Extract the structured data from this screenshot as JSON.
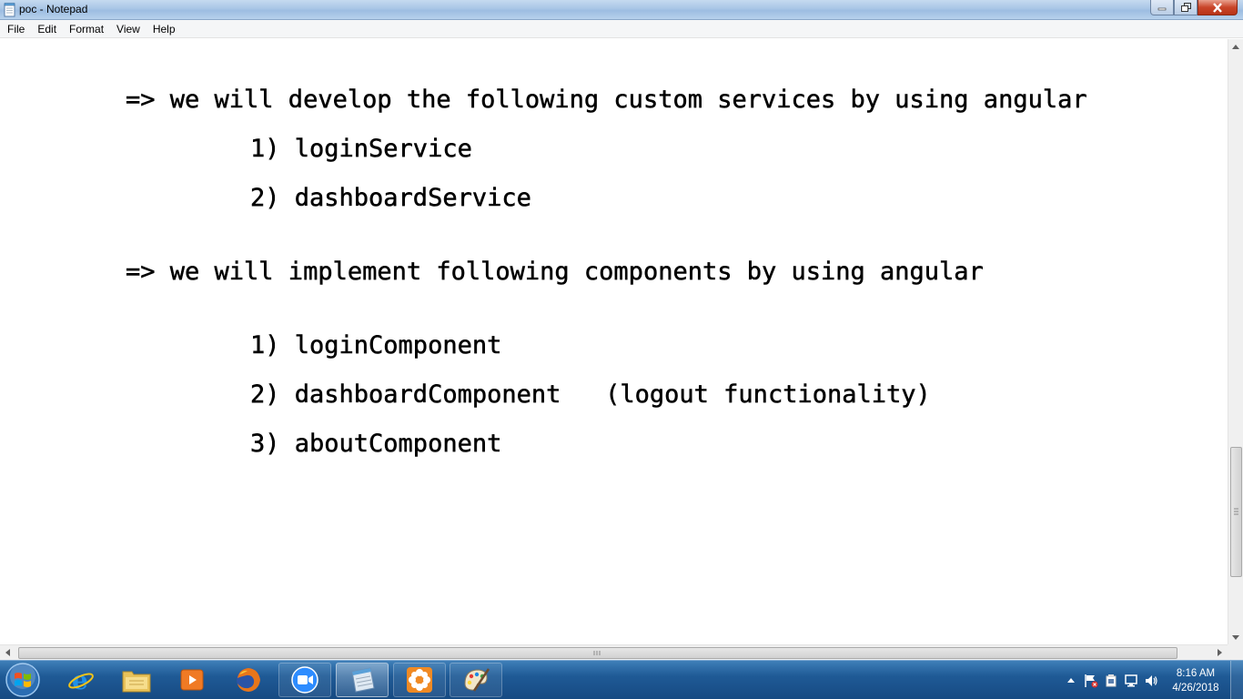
{
  "window": {
    "title": "poc - Notepad"
  },
  "menu": {
    "items": [
      "File",
      "Edit",
      "Format",
      "View",
      "Help"
    ]
  },
  "editor": {
    "lines": [
      "=> we will develop the following custom services by using angular",
      "1) loginService",
      "2) dashboardService",
      "=> we will implement following components by using angular",
      "1) loginComponent",
      "2) dashboardComponent   (logout functionality)",
      "3) aboutComponent"
    ]
  },
  "taskbar": {
    "apps": [
      {
        "icon": "internet-explorer-icon"
      },
      {
        "icon": "file-explorer-icon"
      },
      {
        "icon": "media-player-icon"
      },
      {
        "icon": "firefox-icon"
      },
      {
        "icon": "zoom-icon"
      },
      {
        "icon": "notepad-icon"
      },
      {
        "icon": "flower-app-icon"
      },
      {
        "icon": "paint-icon"
      }
    ],
    "clock": {
      "time": "8:16 AM",
      "date": "4/26/2018"
    }
  },
  "colors": {
    "taskbar": "#1f5a96",
    "titlebar": "#a9c6e6",
    "close_button": "#c9452a"
  }
}
